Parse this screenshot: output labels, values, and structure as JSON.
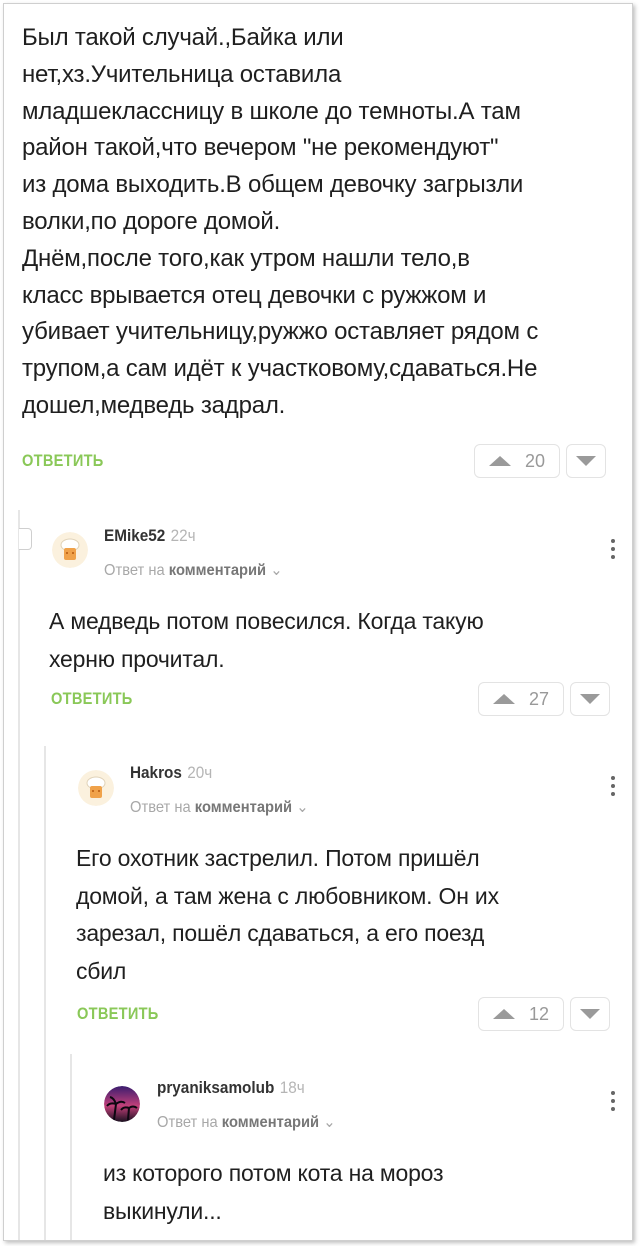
{
  "post": {
    "lines": [
      "Был такой случай.,Байка или",
      "нет,хз.Учительница оставила",
      "младшеклассницу в школе до темноты.А там",
      "район такой,что вечером \"не рекомендуют\"",
      "из дома выходить.В общем девочку загрызли",
      "волки,по дороге домой.",
      "Днём,после того,как утром нашли тело,в",
      "класс врывается отец девочки с ружжом и",
      "убивает учительницу,ружжо оставляет рядом с",
      "трупом,а сам идёт к участковому,сдаваться.Не",
      "дошел,медведь задрал."
    ],
    "reply_label": "ОТВЕТИТЬ",
    "rating": "20"
  },
  "comments": [
    {
      "author": "EMike52",
      "time": "22ч",
      "reply_prefix": "Ответ на",
      "reply_target": "комментарий",
      "lines": [
        "А медведь потом повесился. Когда такую",
        "херню прочитал."
      ],
      "reply_label": "ОТВЕТИТЬ",
      "rating": "27",
      "avatar": "chef-hat-avatar"
    },
    {
      "author": "Hakros",
      "time": "20ч",
      "reply_prefix": "Ответ на",
      "reply_target": "комментарий",
      "lines": [
        "Его охотник застрелил. Потом пришёл",
        "домой, а там жена с любовником. Он их",
        "зарезал, пошёл сдаваться, а его поезд",
        "сбил"
      ],
      "reply_label": "ОТВЕТИТЬ",
      "rating": "12",
      "avatar": "chef-hat-avatar"
    },
    {
      "author": "pryaniksamolub",
      "time": "18ч",
      "reply_prefix": "Ответ на",
      "reply_target": "комментарий",
      "lines": [
        "из которого потом кота на мороз",
        "выкинули..."
      ],
      "avatar": "palm-sunset-avatar"
    }
  ],
  "colors": {
    "accent": "#8ac858",
    "muted": "#b5b5b5",
    "thread": "#e6e6e6"
  }
}
